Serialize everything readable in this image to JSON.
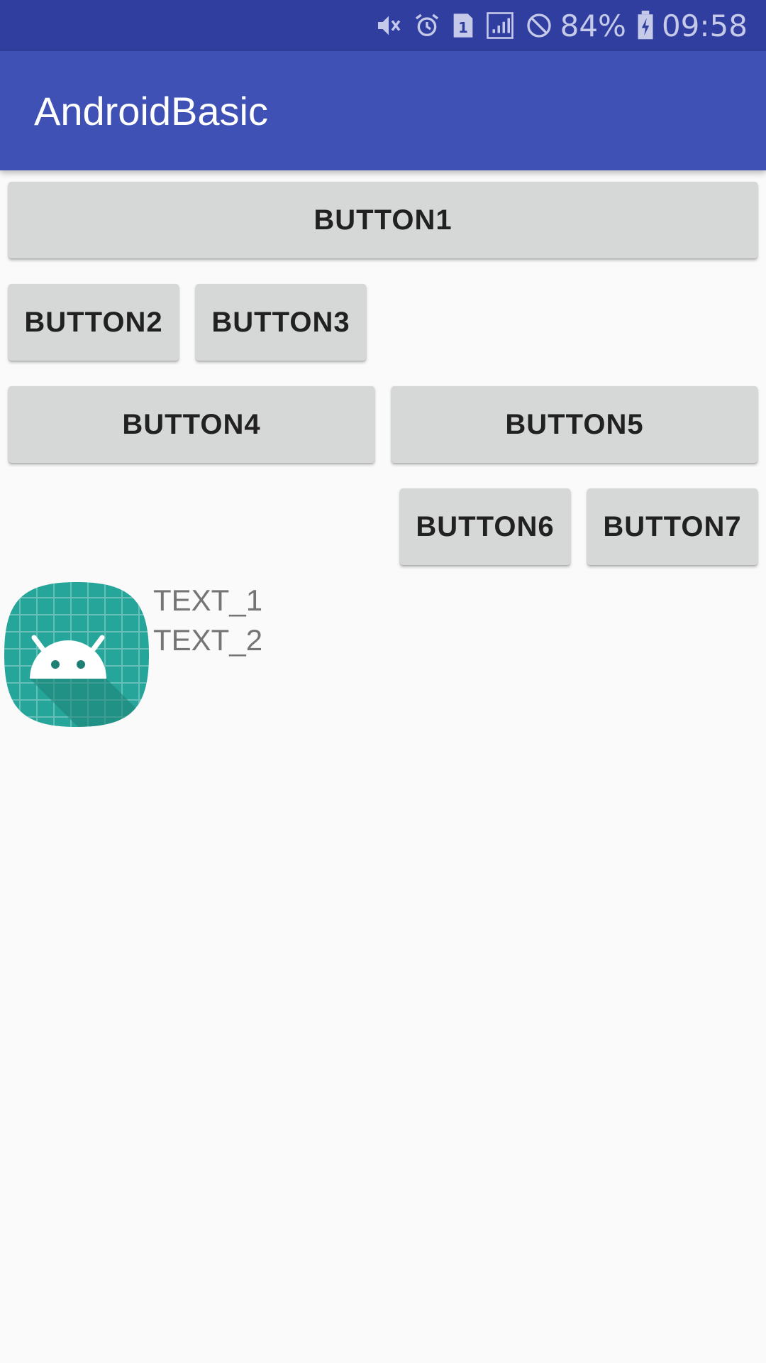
{
  "status_bar": {
    "battery_percent": "84%",
    "time": "09:58",
    "sim_slot": "1",
    "icons": [
      "mute-icon",
      "alarm-icon",
      "sim-icon",
      "signal-icon",
      "no-service-icon",
      "battery-charging-icon"
    ]
  },
  "app_bar": {
    "title": "AndroidBasic"
  },
  "buttons": {
    "b1": "BUTTON1",
    "b2": "BUTTON2",
    "b3": "BUTTON3",
    "b4": "BUTTON4",
    "b5": "BUTTON5",
    "b6": "BUTTON6",
    "b7": "BUTTON7"
  },
  "content": {
    "icon": "android-launcher-icon",
    "text_1": "TEXT_1",
    "text_2": "TEXT_2"
  },
  "colors": {
    "status_bar": "#303f9f",
    "app_bar": "#3f51b5",
    "button_bg": "#d6d7d7",
    "background": "#fafafa",
    "icon_teal": "#26a69a"
  }
}
